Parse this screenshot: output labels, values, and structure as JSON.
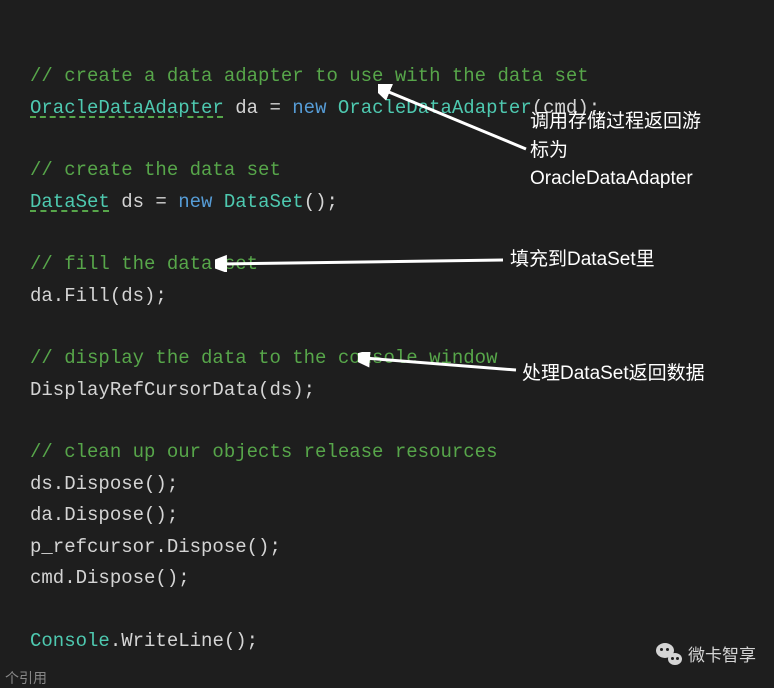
{
  "code": {
    "c1": "// create a data adapter to use with the data set",
    "l1_type1": "OracleDataAdapter",
    "l1_var": " da = ",
    "l1_new": "new",
    "l1_type2": " OracleDataAdapter",
    "l1_rest": "(cmd);",
    "c2": "// create the data set",
    "l2_type1": "DataSet",
    "l2_var": " ds = ",
    "l2_new": "new",
    "l2_type2": " DataSet",
    "l2_rest": "();",
    "c3": "// fill the data set",
    "l3": "da.Fill(ds);",
    "c4": "// display the data to the console window",
    "l4": "DisplayRefCursorData(ds);",
    "c5": "// clean up our objects release resources",
    "l5": "ds.Dispose();",
    "l6": "da.Dispose();",
    "l7": "p_refcursor.Dispose();",
    "l8": "cmd.Dispose();",
    "l9_type": "Console",
    "l9_rest": ".WriteLine();"
  },
  "annotations": {
    "a1_line1": "调用存储过程返回游",
    "a1_line2": "标为",
    "a1_line3": "OracleDataAdapter",
    "a2": "填充到DataSet里",
    "a3": "处理DataSet返回数据"
  },
  "footer": {
    "ref": "个引用",
    "watermark": "微卡智享"
  }
}
